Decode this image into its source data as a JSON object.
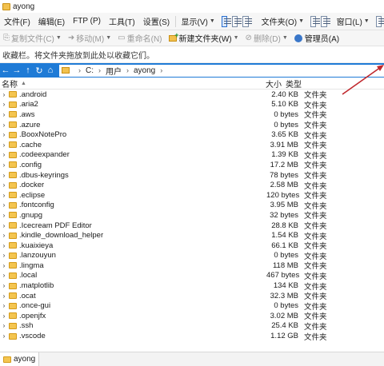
{
  "window": {
    "title": "ayong"
  },
  "menu": {
    "items": [
      {
        "label": "文件(F)",
        "dropdown": false
      },
      {
        "label": "编辑(E)",
        "dropdown": false
      },
      {
        "label": "FTP (P)",
        "dropdown": false
      },
      {
        "label": "工具(T)",
        "dropdown": false
      },
      {
        "label": "设置(S)",
        "dropdown": false
      }
    ],
    "display_label": "显示(V)",
    "favorites_label": "文件夹(O)",
    "window_label": "窗口(L)"
  },
  "toolbar": {
    "copy_label": "复制文件(C)",
    "move_label": "移动(M)",
    "rename_label": "重命名(N)",
    "new_folder_label": "新建文件夹(W)",
    "delete_label": "删除(D)",
    "admin_label": "管理员(A)"
  },
  "infobar": {
    "text": "收藏栏。将文件夹拖放到此处以收藏它们。"
  },
  "address": {
    "crumbs": [
      "C:",
      "用户",
      "ayong"
    ]
  },
  "columns": {
    "name": "名称",
    "size": "大小",
    "type": "类型"
  },
  "files": [
    {
      "name": ".android",
      "size": "2.40 KB",
      "type": "文件夹"
    },
    {
      "name": ".aria2",
      "size": "5.10 KB",
      "type": "文件夹"
    },
    {
      "name": ".aws",
      "size": "0 bytes",
      "type": "文件夹"
    },
    {
      "name": ".azure",
      "size": "0 bytes",
      "type": "文件夹"
    },
    {
      "name": ".BooxNotePro",
      "size": "3.65 KB",
      "type": "文件夹"
    },
    {
      "name": ".cache",
      "size": "3.91 MB",
      "type": "文件夹"
    },
    {
      "name": ".codeexpander",
      "size": "1.39 KB",
      "type": "文件夹"
    },
    {
      "name": ".config",
      "size": "17.2 MB",
      "type": "文件夹"
    },
    {
      "name": ".dbus-keyrings",
      "size": "78 bytes",
      "type": "文件夹"
    },
    {
      "name": ".docker",
      "size": "2.58 MB",
      "type": "文件夹"
    },
    {
      "name": ".eclipse",
      "size": "120 bytes",
      "type": "文件夹"
    },
    {
      "name": ".fontconfig",
      "size": "3.95 MB",
      "type": "文件夹"
    },
    {
      "name": ".gnupg",
      "size": "32 bytes",
      "type": "文件夹"
    },
    {
      "name": ".Icecream PDF Editor",
      "size": "28.8 KB",
      "type": "文件夹"
    },
    {
      "name": ".kindle_download_helper",
      "size": "1.54 KB",
      "type": "文件夹"
    },
    {
      "name": ".kuaixieya",
      "size": "66.1 KB",
      "type": "文件夹"
    },
    {
      "name": ".lanzouyun",
      "size": "0 bytes",
      "type": "文件夹"
    },
    {
      "name": ".lingma",
      "size": "118 MB",
      "type": "文件夹"
    },
    {
      "name": ".local",
      "size": "467 bytes",
      "type": "文件夹"
    },
    {
      "name": ".matplotlib",
      "size": "134 KB",
      "type": "文件夹"
    },
    {
      "name": ".ocat",
      "size": "32.3 MB",
      "type": "文件夹"
    },
    {
      "name": ".once-gui",
      "size": "0 bytes",
      "type": "文件夹"
    },
    {
      "name": ".openjfx",
      "size": "3.02 MB",
      "type": "文件夹"
    },
    {
      "name": ".ssh",
      "size": "25.4 KB",
      "type": "文件夹"
    },
    {
      "name": ".vscode",
      "size": "1.12 GB",
      "type": "文件夹"
    }
  ],
  "statusbar": {
    "tab_label": "ayong"
  },
  "colors": {
    "address_bar": "#1f7bd6",
    "folder": "#f4c550",
    "annotation_arrow": "#c0282d"
  }
}
